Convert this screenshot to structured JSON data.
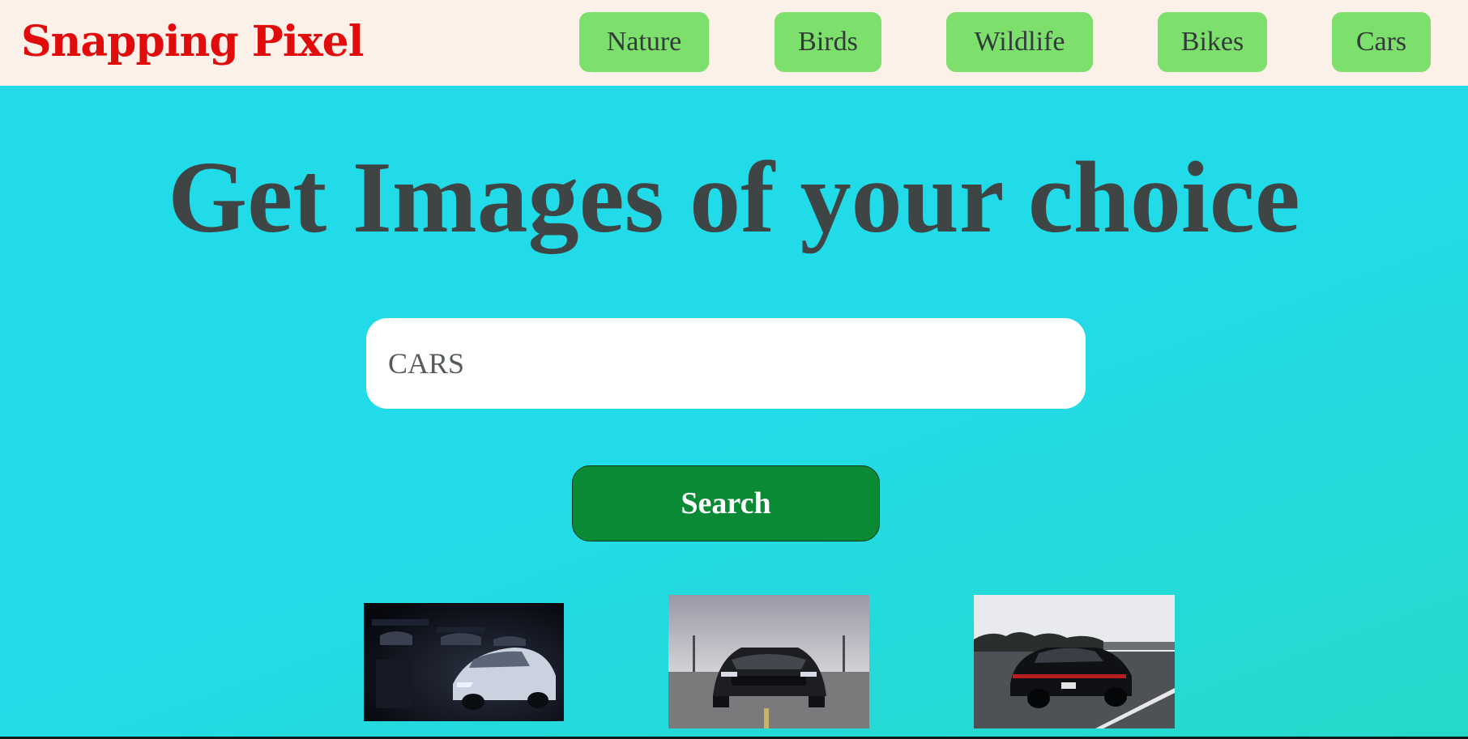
{
  "brand": {
    "name": "Snapping Pixel",
    "color": "#e20b0b"
  },
  "nav": {
    "items": [
      {
        "label": "Nature"
      },
      {
        "label": "Birds"
      },
      {
        "label": "Wildlife"
      },
      {
        "label": "Bikes"
      },
      {
        "label": "Cars"
      }
    ],
    "button_color": "#7ddf6c"
  },
  "hero": {
    "headline": "Get Images of your choice"
  },
  "search": {
    "value": "CARS",
    "button_label": "Search",
    "button_color": "#0a8a34"
  },
  "results": {
    "images": [
      {
        "icon": "car-photo-icon",
        "subject": "white sports car in dark garage"
      },
      {
        "icon": "car-photo-icon",
        "subject": "black muscle car front view under cloudy sky"
      },
      {
        "icon": "car-photo-icon",
        "subject": "black sedan driving on highway"
      }
    ]
  },
  "colors": {
    "background": "#22dbe8",
    "navbar": "#fcf1e9",
    "headline": "#3f4545"
  }
}
